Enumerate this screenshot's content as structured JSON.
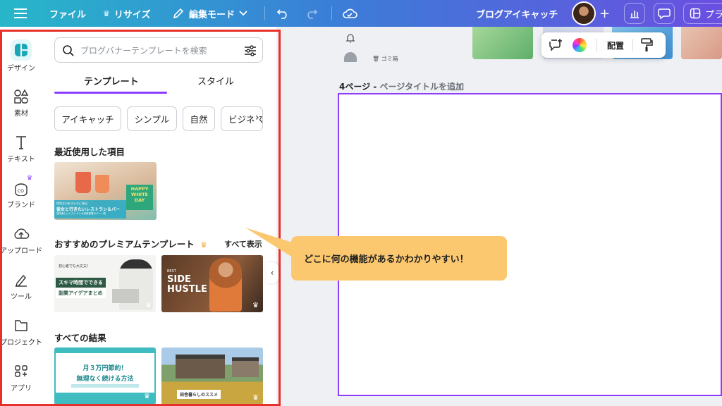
{
  "topbar": {
    "file_label": "ファイル",
    "resize_label": "リサイズ",
    "edit_mode_label": "編集モード",
    "document_title": "ブログアイキャッチ",
    "plus_label": "+",
    "truncated_right": "プラ"
  },
  "rail": {
    "items": [
      {
        "label": "デザイン",
        "icon": "design-icon"
      },
      {
        "label": "素材",
        "icon": "elements-icon"
      },
      {
        "label": "テキスト",
        "icon": "text-icon"
      },
      {
        "label": "ブランド",
        "icon": "brand-icon"
      },
      {
        "label": "アップロード",
        "icon": "upload-icon"
      },
      {
        "label": "ツール",
        "icon": "tools-icon"
      },
      {
        "label": "プロジェクト",
        "icon": "folder-icon"
      },
      {
        "label": "アプリ",
        "icon": "apps-icon"
      }
    ]
  },
  "panel": {
    "search_placeholder": "ブログバナーテンプレートを検索",
    "tabs": [
      "テンプレート",
      "スタイル"
    ],
    "chips": [
      "アイキャッチ",
      "シンプル",
      "自然",
      "ビジネス"
    ],
    "recent_title": "最近使用した項目",
    "premium_title": "おすすめのプレミアムテンプレート",
    "show_all": "すべて表示",
    "results_title": "すべての結果",
    "thumbs": {
      "recent": {
        "headline": "HAPPY WHITE DAY",
        "caption": "彼女と行きたいレストラン＆バー",
        "small_top": "特別な日をステキに演出",
        "small_bottom": "週末楽しいレストラン＆深夜営業のバー一覧"
      },
      "premium1": {
        "small_top": "初心者でも大丈夫！",
        "line1": "スキマ時間でできる",
        "line2": "副業アイデアまとめ"
      },
      "premium2": {
        "small_top": "BEST",
        "line1": "SIDE",
        "line2": "HUSTLE"
      },
      "result1": {
        "line1": "月３万円節約！",
        "line2": "無理なく続ける方法"
      },
      "result2": {
        "line1": "田舎暮らしのススメ"
      }
    }
  },
  "canvas": {
    "page_label": "4ページ - ",
    "page_title_placeholder": "ページタイトルを追加",
    "toolbar_arrange": "配置",
    "strip_label": "ゴミ箱"
  },
  "callout": {
    "text": "どこに何の機能があるかわかりやすい！"
  },
  "colors": {
    "accent": "#8b3dff",
    "highlight_border": "#e8302a",
    "callout_bg": "#fbc870"
  }
}
